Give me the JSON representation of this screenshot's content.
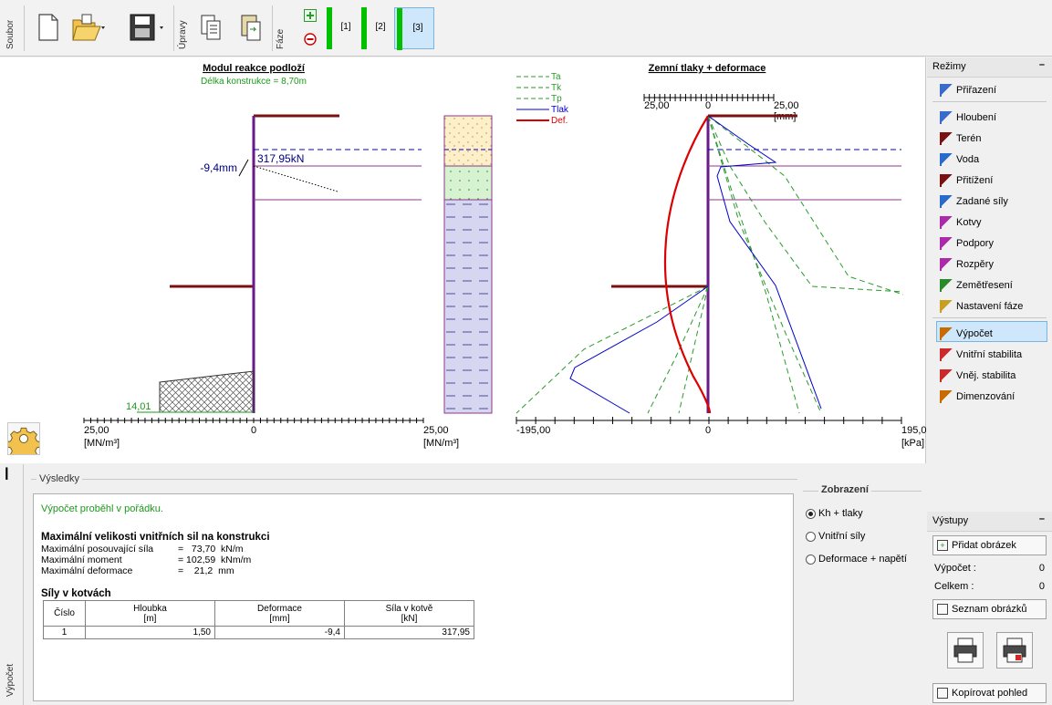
{
  "toolbar": {
    "soubor_label": "Soubor",
    "upravy_label": "Úpravy",
    "faze_label": "Fáze",
    "phases": [
      "[1]",
      "[2]",
      "[3]"
    ],
    "active_phase": "[3]"
  },
  "chart_left": {
    "title": "Modul reakce podloží",
    "subtitle": "Délka konstrukce = 8,70m",
    "deformation_label": "-9,4mm",
    "force_label": "317,95kN",
    "bottom_value_label": "14,01",
    "axis_left": "25,00",
    "axis_zero": "0",
    "axis_right": "25,00",
    "unit_left": "[MN/m³]",
    "unit_right": "[MN/m³]"
  },
  "chart_right": {
    "title": "Zemní tlaky + deformace",
    "legend": [
      {
        "label": "Ta",
        "color": "#2a9a2a"
      },
      {
        "label": "Tk",
        "color": "#2a9a2a"
      },
      {
        "label": "Tp",
        "color": "#2a9a2a"
      },
      {
        "label": "Tlak",
        "color": "#0000cc"
      },
      {
        "label": "Def.",
        "color": "#dd0000"
      }
    ],
    "top_axis_left": "25,00",
    "top_axis_zero": "0",
    "top_axis_right": "25,00",
    "top_axis_unit": "[mm]",
    "axis_left": "-195,00",
    "axis_zero": "0",
    "axis_right": "195,0",
    "unit": "[kPa]"
  },
  "modes": {
    "title": "Režimy",
    "items": [
      {
        "label": "Přiřazení",
        "icon": "assign-icon"
      },
      {
        "label": "Hloubení",
        "icon": "excavation-icon"
      },
      {
        "label": "Terén",
        "icon": "terrain-icon"
      },
      {
        "label": "Voda",
        "icon": "water-icon"
      },
      {
        "label": "Přitížení",
        "icon": "surcharge-icon"
      },
      {
        "label": "Zadané síly",
        "icon": "forces-icon"
      },
      {
        "label": "Kotvy",
        "icon": "anchors-icon"
      },
      {
        "label": "Podpory",
        "icon": "supports-icon"
      },
      {
        "label": "Rozpěry",
        "icon": "struts-icon"
      },
      {
        "label": "Zemětřesení",
        "icon": "earthquake-icon"
      },
      {
        "label": "Nastavení fáze",
        "icon": "phase-settings-icon"
      },
      {
        "label": "Výpočet",
        "icon": "analysis-icon"
      },
      {
        "label": "Vnitřní stabilita",
        "icon": "internal-stability-icon"
      },
      {
        "label": "Vněj. stabilita",
        "icon": "external-stability-icon"
      },
      {
        "label": "Dimenzování",
        "icon": "design-icon"
      }
    ],
    "active": "Výpočet"
  },
  "outputs": {
    "title": "Výstupy",
    "add_image": "Přidat obrázek",
    "calc_label": "Výpočet :",
    "calc_value": "0",
    "total_label": "Celkem :",
    "total_value": "0",
    "image_list": "Seznam obrázků",
    "copy_view": "Kopírovat pohled"
  },
  "bottom": {
    "side_tab": "Výpočet",
    "results_title": "Výsledky",
    "status": "Výpočet proběhl v pořádku.",
    "forces_title": "Maximální velikosti vnitřních sil na konstrukci",
    "shear_label": "Maximální posouvající síla",
    "shear_value": "=   73,70  kN/m",
    "moment_label": "Maximální moment",
    "moment_value": "= 102,59  kNm/m",
    "deform_label": "Maximální deformace",
    "deform_value": "=    21,2  mm",
    "anchors_title": "Síly v kotvách",
    "table_headers": [
      {
        "top": "Číslo",
        "bottom": ""
      },
      {
        "top": "Hloubka",
        "bottom": "[m]"
      },
      {
        "top": "Deformace",
        "bottom": "[mm]"
      },
      {
        "top": "Síla v kotvě",
        "bottom": "[kN]"
      }
    ],
    "table_rows": [
      [
        "1",
        "1,50",
        "-9,4",
        "317,95"
      ]
    ],
    "display_title": "Zobrazení",
    "radio_kh": "Kh + tlaky",
    "radio_internal": "Vnitřní síly",
    "radio_deform": "Deformace + napětí"
  }
}
